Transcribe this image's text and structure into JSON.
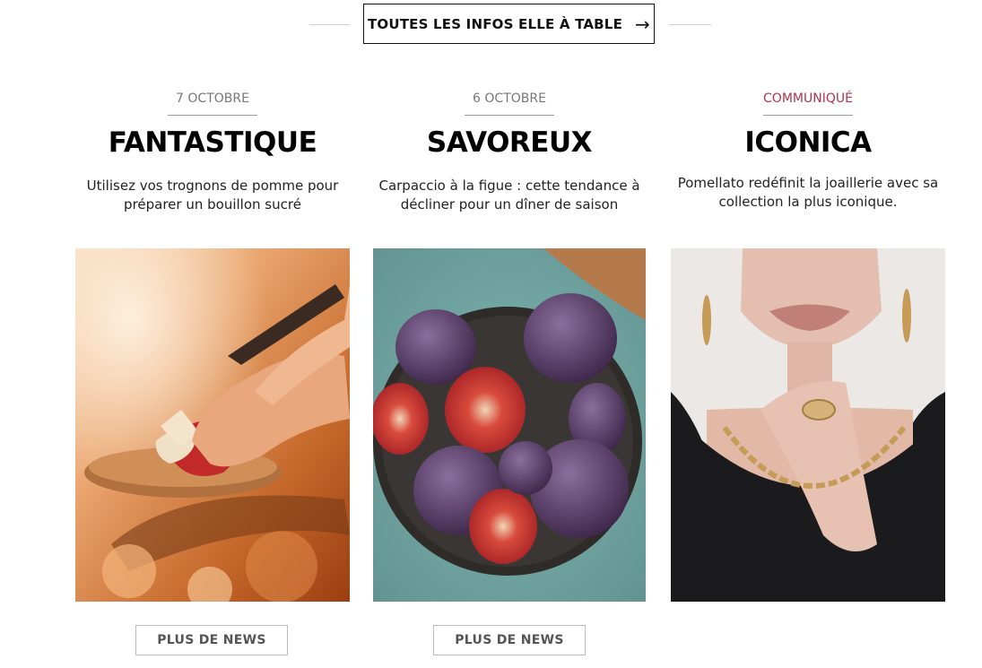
{
  "header": {
    "cta_label": "TOUTES LES INFOS ELLE À TABLE",
    "cta_arrow": "→"
  },
  "cards": [
    {
      "date": "7 OCTOBRE",
      "title": "FANTASTIQUE",
      "desc_line1": "Utilisez vos trognons de pomme pour",
      "desc_line2": "préparer un bouillon sucré",
      "image_alt": "mains coupant une pomme sur une planche"
    },
    {
      "date": "6 OCTOBRE",
      "title": "SAVOREUX",
      "desc_line1": "Carpaccio à la figue : cette tendance à",
      "desc_line2": "décliner pour un dîner de saison",
      "image_alt": "bol de figues fraîches"
    },
    {
      "date": "COMMUNIQUÉ",
      "title": "ICONICA",
      "desc_line1": "Pomellato redéfinit la joaillerie avec sa",
      "desc_line2": "collection la plus iconique.",
      "image_alt": "femme portant des bijoux en or"
    }
  ],
  "footer": {
    "more_label_1": "PLUS DE NEWS",
    "more_label_2": "PLUS DE NEWS"
  },
  "colors": {
    "sponsored": "#b0344d",
    "text": "#111111",
    "muted": "#777777"
  }
}
